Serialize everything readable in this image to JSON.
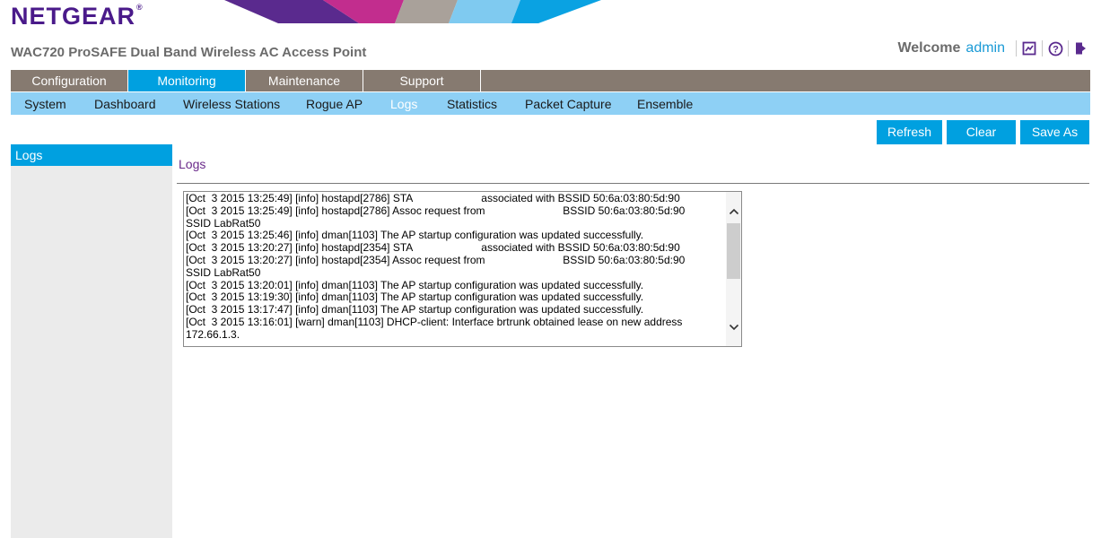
{
  "brand": {
    "logo_text": "NETGEAR",
    "reg_mark": "®",
    "color": "#4a1a8a"
  },
  "product": {
    "title": "WAC720 ProSAFE Dual Band Wireless AC Access Point"
  },
  "welcome": {
    "label": "Welcome",
    "user": "admin",
    "icons": [
      "report-icon",
      "help-icon",
      "logout-icon"
    ]
  },
  "main_nav": {
    "tabs": [
      {
        "label": "Configuration",
        "active": false
      },
      {
        "label": "Monitoring",
        "active": true
      },
      {
        "label": "Maintenance",
        "active": false
      },
      {
        "label": "Support",
        "active": false
      }
    ]
  },
  "sub_nav": {
    "tabs": [
      {
        "label": "System",
        "active": false
      },
      {
        "label": "Dashboard",
        "active": false
      },
      {
        "label": "Wireless Stations",
        "active": false
      },
      {
        "label": "Rogue AP",
        "active": false
      },
      {
        "label": "Logs",
        "active": true
      },
      {
        "label": "Statistics",
        "active": false
      },
      {
        "label": "Packet Capture",
        "active": false
      },
      {
        "label": "Ensemble",
        "active": false
      }
    ]
  },
  "actions": {
    "refresh": "Refresh",
    "clear": "Clear",
    "save_as": "Save As"
  },
  "sidebar": {
    "items": [
      {
        "label": "Logs",
        "active": true
      }
    ]
  },
  "section": {
    "title": "Logs"
  },
  "logs": {
    "lines": [
      "[Oct  3 2015 13:25:49] [info] hostapd[2786] STA                       associated with BSSID 50:6a:03:80:5d:90",
      "[Oct  3 2015 13:25:49] [info] hostapd[2786] Assoc request from                          BSSID 50:6a:03:80:5d:90",
      "SSID LabRat50",
      "[Oct  3 2015 13:25:46] [info] dman[1103] The AP startup configuration was updated successfully.",
      "[Oct  3 2015 13:20:27] [info] hostapd[2354] STA                       associated with BSSID 50:6a:03:80:5d:90",
      "[Oct  3 2015 13:20:27] [info] hostapd[2354] Assoc request from                          BSSID 50:6a:03:80:5d:90",
      "SSID LabRat50",
      "[Oct  3 2015 13:20:01] [info] dman[1103] The AP startup configuration was updated successfully.",
      "[Oct  3 2015 13:19:30] [info] dman[1103] The AP startup configuration was updated successfully.",
      "[Oct  3 2015 13:17:47] [info] dman[1103] The AP startup configuration was updated successfully.",
      "[Oct  3 2015 13:16:01] [warn] dman[1103] DHCP-client: Interface brtrunk obtained lease on new address",
      "172.66.1.3."
    ]
  },
  "colors": {
    "accent": "#00a0e0",
    "main_nav_bg": "#867a70",
    "sub_nav_bg": "#8ed0f5",
    "title_purple": "#6a2a8a",
    "sidebar_bg": "#ebebeb"
  }
}
